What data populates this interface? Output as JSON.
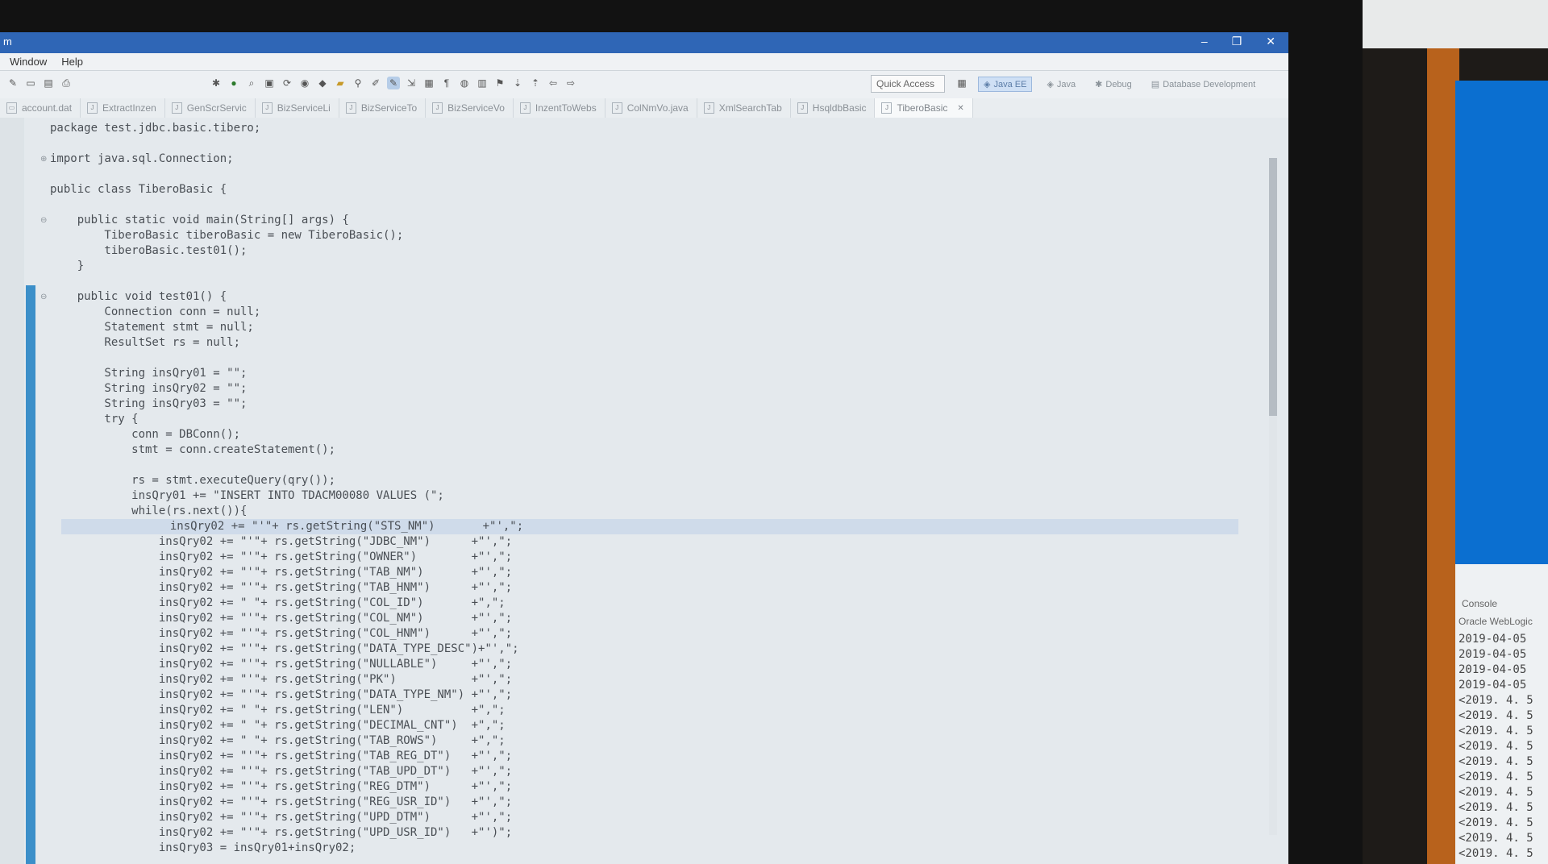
{
  "window": {
    "title_fragment": "m"
  },
  "menu": [
    "Window",
    "Help"
  ],
  "toolbar": {
    "quick_access": "Quick Access"
  },
  "perspectives": [
    {
      "label": "Java EE",
      "active": true
    },
    {
      "label": "Java",
      "active": false
    },
    {
      "label": "Debug",
      "active": false
    },
    {
      "label": "Database Development",
      "active": false
    }
  ],
  "tabs": [
    {
      "label": "account.dat",
      "active": false
    },
    {
      "label": "ExtractInzen",
      "active": false
    },
    {
      "label": "GenScrServic",
      "active": false
    },
    {
      "label": "BizServiceLi",
      "active": false
    },
    {
      "label": "BizServiceTo",
      "active": false
    },
    {
      "label": "BizServiceVo",
      "active": false
    },
    {
      "label": "InzentToWebs",
      "active": false
    },
    {
      "label": "ColNmVo.java",
      "active": false
    },
    {
      "label": "XmlSearchTab",
      "active": false
    },
    {
      "label": "HsqldbBasic",
      "active": false
    },
    {
      "label": "TiberoBasic",
      "active": true
    }
  ],
  "code_lines": [
    "package test.jdbc.basic.tibero;",
    "",
    "import java.sql.Connection;",
    "",
    "public class TiberoBasic {",
    "",
    "    public static void main(String[] args) {",
    "        TiberoBasic tiberoBasic = new TiberoBasic();",
    "        tiberoBasic.test01();",
    "    }",
    "",
    "    public void test01() {",
    "        Connection conn = null;",
    "        Statement stmt = null;",
    "        ResultSet rs = null;",
    "",
    "        String insQry01 = \"\";",
    "        String insQry02 = \"\";",
    "        String insQry03 = \"\";",
    "        try {",
    "            conn = DBConn();",
    "            stmt = conn.createStatement();",
    "",
    "            rs = stmt.executeQuery(qry());",
    "            insQry01 += \"INSERT INTO TDACM00080 VALUES (\";",
    "            while(rs.next()){",
    "                insQry02 += \"'\"+ rs.getString(\"STS_NM\")       +\"',\";",
    "                insQry02 += \"'\"+ rs.getString(\"JDBC_NM\")      +\"',\";",
    "                insQry02 += \"'\"+ rs.getString(\"OWNER\")        +\"',\";",
    "                insQry02 += \"'\"+ rs.getString(\"TAB_NM\")       +\"',\";",
    "                insQry02 += \"'\"+ rs.getString(\"TAB_HNM\")      +\"',\";",
    "                insQry02 += \" \"+ rs.getString(\"COL_ID\")       +\",\";",
    "                insQry02 += \"'\"+ rs.getString(\"COL_NM\")       +\"',\";",
    "                insQry02 += \"'\"+ rs.getString(\"COL_HNM\")      +\"',\";",
    "                insQry02 += \"'\"+ rs.getString(\"DATA_TYPE_DESC\")+\"',\";",
    "                insQry02 += \"'\"+ rs.getString(\"NULLABLE\")     +\"',\";",
    "                insQry02 += \"'\"+ rs.getString(\"PK\")           +\"',\";",
    "                insQry02 += \"'\"+ rs.getString(\"DATA_TYPE_NM\") +\"',\";",
    "                insQry02 += \" \"+ rs.getString(\"LEN\")          +\",\";",
    "                insQry02 += \" \"+ rs.getString(\"DECIMAL_CNT\")  +\",\";",
    "                insQry02 += \" \"+ rs.getString(\"TAB_ROWS\")     +\",\";",
    "                insQry02 += \"'\"+ rs.getString(\"TAB_REG_DT\")   +\"',\";",
    "                insQry02 += \"'\"+ rs.getString(\"TAB_UPD_DT\")   +\"',\";",
    "                insQry02 += \"'\"+ rs.getString(\"REG_DTM\")      +\"',\";",
    "                insQry02 += \"'\"+ rs.getString(\"REG_USR_ID\")   +\"',\";",
    "                insQry02 += \"'\"+ rs.getString(\"UPD_DTM\")      +\"',\";",
    "                insQry02 += \"'\"+ rs.getString(\"UPD_USR_ID\")   +\"')\";",
    "                insQry03 = insQry01+insQry02;"
  ],
  "console": {
    "title": "Console",
    "subtitle": "Oracle WebLogic",
    "lines": [
      "2019-04-05",
      "2019-04-05",
      "2019-04-05",
      "2019-04-05",
      "<2019. 4. 5",
      "<2019. 4. 5",
      "<2019. 4. 5",
      "<2019. 4. 5",
      "<2019. 4. 5",
      "<2019. 4. 5",
      "<2019. 4. 5",
      "<2019. 4. 5",
      "<2019. 4. 5",
      "<2019. 4. 5",
      "<2019. 4. 5"
    ]
  }
}
